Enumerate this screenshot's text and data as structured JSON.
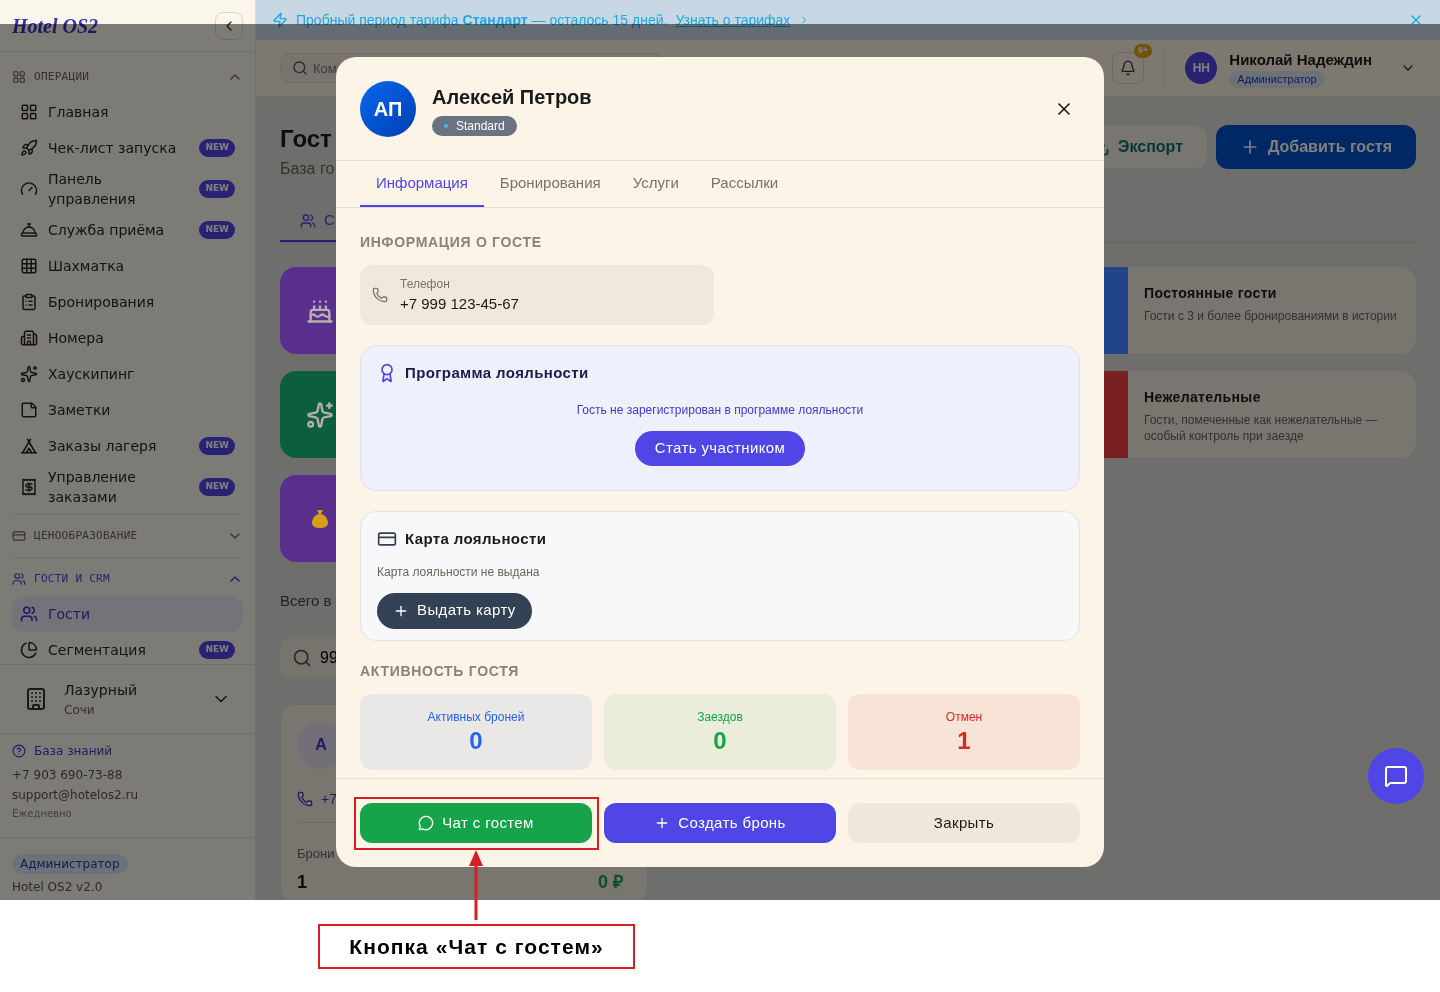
{
  "banner": {
    "text": "Пробный период тарифа **Стандарт** — осталось 15 дней.",
    "link": "Узнать о тарифах"
  },
  "sidebar": {
    "logo": "Hotel OS2",
    "sections": [
      {
        "title": "ОПЕРАЦИИ",
        "expanded": true,
        "items": [
          {
            "label": "Главная",
            "selected": false
          },
          {
            "label": "Чек-лист запуска",
            "badge": "NEW",
            "selected": false
          },
          {
            "label": "Панель управления",
            "badge": "NEW",
            "selected": false
          },
          {
            "label": "Служба приёма",
            "badge": "NEW",
            "selected": false
          },
          {
            "label": "Шахматка",
            "selected": false
          },
          {
            "label": "Бронирования",
            "selected": false
          },
          {
            "label": "Номера",
            "selected": false
          },
          {
            "label": "Хаускипинг",
            "selected": false
          },
          {
            "label": "Заметки",
            "selected": false
          },
          {
            "label": "Заказы лагеря",
            "badge": "NEW",
            "selected": false
          },
          {
            "label": "Управление заказами",
            "badge": "NEW",
            "selected": false
          }
        ]
      },
      {
        "title": "ЦЕНООБРАЗОВАНИЕ",
        "expanded": false
      },
      {
        "title": "ГОСТИ И CRM",
        "expanded": true,
        "items": [
          {
            "label": "Гости",
            "selected": true
          },
          {
            "label": "Сегментация",
            "badge": "NEW",
            "selected": false
          }
        ]
      }
    ],
    "hotel": {
      "name": "Лазурный",
      "city": "Сочи"
    },
    "help": {
      "link": "База знаний",
      "phone": "+7 903 690-73-88",
      "email": "support@hotelos2.ru",
      "hours": "Ежедневно"
    },
    "footer": {
      "role": "Администратор",
      "version": "Hotel OS2 v2.0"
    }
  },
  "topbar": {
    "search_placeholder": "Ком",
    "notifications": "9+",
    "user": {
      "initials": "НН",
      "name": "Николай Надеждин",
      "role": "Администратор"
    }
  },
  "page": {
    "title": "Гост",
    "subtitle": "База го",
    "tab": {
      "label": "С",
      "selected": true
    },
    "buttons": [
      {
        "kind": "export",
        "label": "Экспорт"
      },
      {
        "kind": "add",
        "label": "Добавить гостя"
      }
    ],
    "segment_tiles": [
      {
        "color": "#5a2e8c"
      },
      {
        "color": "#0b5e3e"
      },
      {
        "color": "#5a2e8c"
      }
    ],
    "segment_cards": [
      {
        "color": "#21448a",
        "title": "Постоянные гости",
        "description": "Гости с 3 и более бронированиями в истории"
      },
      {
        "color": "#7a1f22",
        "title": "Нежелательные",
        "description": "Гости, помеченные как нежелательные — особый контроль при заезде"
      }
    ],
    "total": "Всего в",
    "search_value": "99",
    "guest": {
      "initial": "А",
      "phone": "+7",
      "bookings_label": "Брони",
      "bookings": "1",
      "amount": "0 ₽"
    }
  },
  "modal": {
    "initials": "АП",
    "name": "Алексей Петров",
    "tier": "Standard",
    "tabs": [
      {
        "label": "Информация",
        "selected": true
      },
      {
        "label": "Бронирования",
        "selected": false
      },
      {
        "label": "Услуги",
        "selected": false
      },
      {
        "label": "Рассылки",
        "selected": false
      }
    ],
    "info_heading": "ИНФОРМАЦИЯ О ГОСТЕ",
    "phone": {
      "label": "Телефон",
      "value": "+7 999 123-45-67"
    },
    "loyalty_program": {
      "title": "Программа лояльности",
      "message": "Гость не зарегистрирован в программе лояльности",
      "button": "Стать участником"
    },
    "loyalty_card": {
      "title": "Карта лояльности",
      "message": "Карта лояльности не выдана",
      "button": "Выдать карту"
    },
    "activity_heading": "АКТИВНОСТЬ ГОСТЯ",
    "stats": [
      {
        "label": "Активных броней",
        "value": "0",
        "color": "#2563eb"
      },
      {
        "label": "Заездов",
        "value": "0",
        "color": "#16a34a"
      },
      {
        "label": "Отмен",
        "value": "1",
        "color": "#dc2626"
      }
    ],
    "actions": [
      {
        "kind": "chat",
        "label": "Чат с гостем"
      },
      {
        "kind": "create",
        "label": "Создать бронь"
      },
      {
        "kind": "close",
        "label": "Закрыть"
      }
    ]
  },
  "annotation": {
    "label": "Кнопка «Чат с гостем»"
  }
}
